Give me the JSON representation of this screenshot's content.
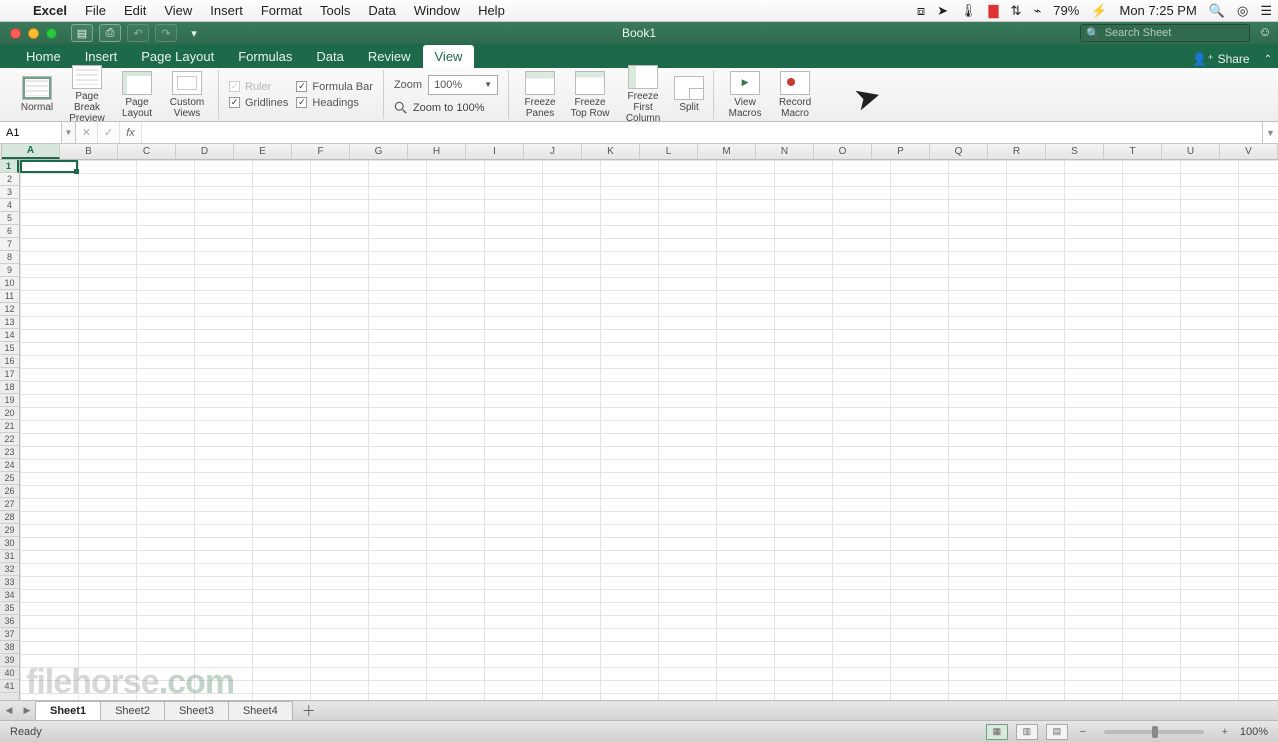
{
  "menubar": {
    "app": "Excel",
    "items": [
      "File",
      "Edit",
      "View",
      "Insert",
      "Format",
      "Tools",
      "Data",
      "Window",
      "Help"
    ],
    "battery": "79%",
    "time": "Mon 7:25 PM"
  },
  "window": {
    "title": "Book1",
    "search_placeholder": "Search Sheet"
  },
  "ribbon": {
    "tabs": [
      "Home",
      "Insert",
      "Page Layout",
      "Formulas",
      "Data",
      "Review",
      "View"
    ],
    "active_tab": "View",
    "share": "Share",
    "view_group": {
      "normal": "Normal",
      "page_break": "Page Break\nPreview",
      "page_layout": "Page\nLayout",
      "custom_views": "Custom\nViews"
    },
    "show": {
      "ruler": "Ruler",
      "gridlines": "Gridlines",
      "formula_bar": "Formula Bar",
      "headings": "Headings"
    },
    "zoom": {
      "label": "Zoom",
      "value": "100%",
      "to100": "Zoom to 100%"
    },
    "freeze": {
      "panes": "Freeze\nPanes",
      "top_row": "Freeze\nTop Row",
      "first_col": "Freeze First\nColumn",
      "split": "Split"
    },
    "macros": {
      "view": "View\nMacros",
      "record": "Record\nMacro"
    }
  },
  "formula_bar": {
    "name_box": "A1",
    "fx": "fx",
    "formula": ""
  },
  "grid": {
    "columns": [
      "A",
      "B",
      "C",
      "D",
      "E",
      "F",
      "G",
      "H",
      "I",
      "J",
      "K",
      "L",
      "M",
      "N",
      "O",
      "P",
      "Q",
      "R",
      "S",
      "T",
      "U",
      "V"
    ],
    "row_count": 41,
    "selected_col": "A",
    "selected_row": 1
  },
  "sheets": {
    "tabs": [
      "Sheet1",
      "Sheet2",
      "Sheet3",
      "Sheet4"
    ],
    "active": "Sheet1"
  },
  "statusbar": {
    "ready": "Ready",
    "zoom": "100%"
  },
  "watermark": {
    "a": "filehorse",
    "b": ".com"
  }
}
